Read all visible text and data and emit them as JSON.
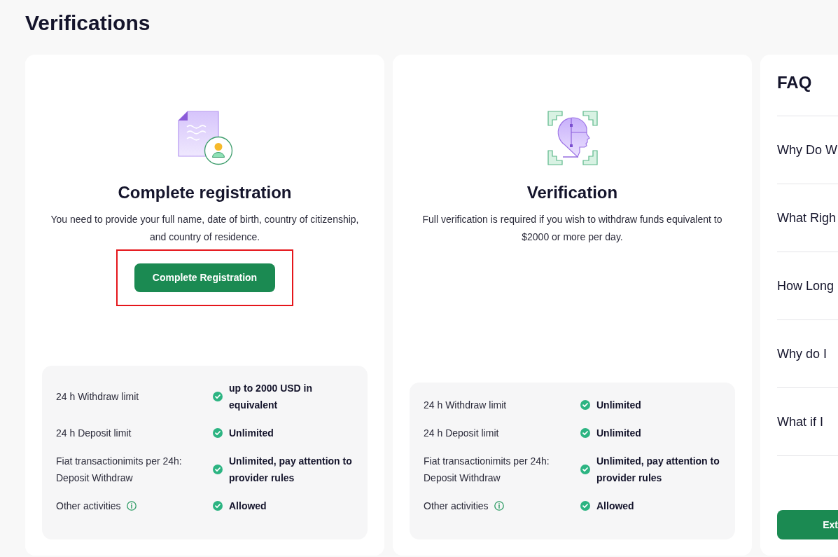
{
  "page": {
    "title": "Verifications"
  },
  "cards": [
    {
      "kind": "document",
      "title": "Complete registration",
      "description": "You need to provide your full name, date of birth, country of citizenship, and country of residence.",
      "button": {
        "label": "Complete Registration",
        "highlighted": true
      },
      "limits": [
        {
          "label": "24 h Withdraw limit",
          "value": "up to 2000 USD in equivalent",
          "info": false
        },
        {
          "label": "24 h Deposit limit",
          "value": "Unlimited",
          "info": false
        },
        {
          "label": "Fiat transactionimits per 24h: Deposit Withdraw",
          "value": "Unlimited, pay attention to provider rules",
          "info": false
        },
        {
          "label": "Other activities",
          "value": "Allowed",
          "info": true
        }
      ]
    },
    {
      "kind": "face-scan",
      "title": "Verification",
      "description": "Full verification is required if you wish to withdraw funds equivalent to $2000 or more per day.",
      "limits": [
        {
          "label": "24 h Withdraw limit",
          "value": "Unlimited",
          "info": false
        },
        {
          "label": "24 h Deposit limit",
          "value": "Unlimited",
          "info": false
        },
        {
          "label": "Fiat transactionimits per 24h: Deposit Withdraw",
          "value": "Unlimited, pay attention to provider rules",
          "info": false
        },
        {
          "label": "Other activities",
          "value": "Allowed",
          "info": true
        }
      ]
    }
  ],
  "faq": {
    "title": "FAQ",
    "items": [
      "Why Do W",
      "What Righ",
      "How Long",
      "Why do I",
      "What if I"
    ],
    "button": {
      "label": "Ext"
    }
  }
}
